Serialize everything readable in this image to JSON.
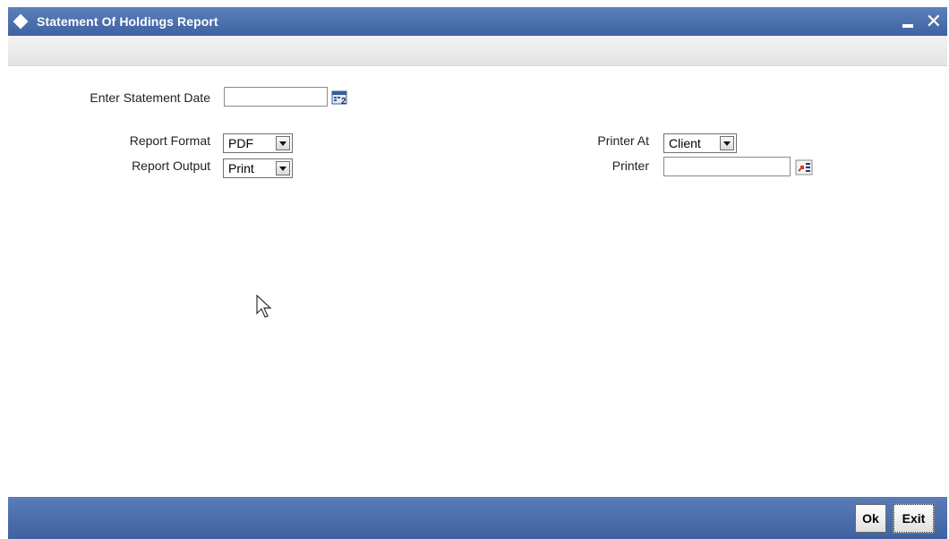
{
  "window": {
    "title": "Statement Of Holdings Report",
    "minimize_icon": "minimize-icon",
    "close_icon": "close-icon"
  },
  "form": {
    "statement_date": {
      "label": "Enter Statement Date",
      "value": "",
      "icon": "calendar-icon"
    },
    "report_format": {
      "label": "Report Format",
      "value": "PDF"
    },
    "report_output": {
      "label": "Report Output",
      "value": "Print"
    },
    "printer_at": {
      "label": "Printer At",
      "value": "Client"
    },
    "printer": {
      "label": "Printer",
      "value": "",
      "icon": "lookup-icon"
    }
  },
  "footer": {
    "ok_label": "Ok",
    "exit_label": "Exit"
  },
  "colors": {
    "titlebar": "#4a6eae",
    "footer": "#4a6eae",
    "toolstrip": "#ebebeb"
  }
}
